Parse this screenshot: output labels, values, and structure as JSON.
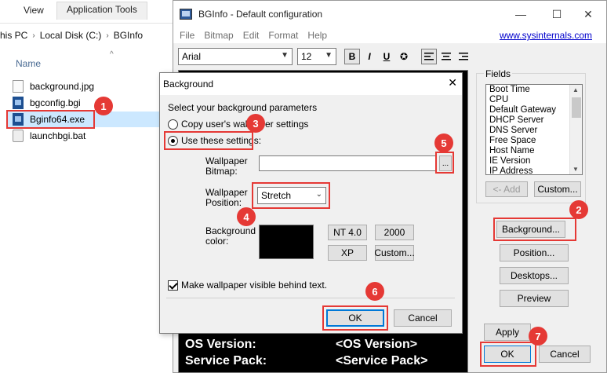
{
  "explorer": {
    "tabs": [
      "View",
      "Application Tools"
    ],
    "breadcrumb": [
      "his PC",
      "Local Disk (C:)",
      "BGInfo"
    ],
    "column_header": "Name",
    "files": [
      {
        "name": "background.jpg"
      },
      {
        "name": "bgconfig.bgi"
      },
      {
        "name": "Bginfo64.exe"
      },
      {
        "name": "launchbgi.bat"
      }
    ]
  },
  "bginfo": {
    "title": "BGInfo - Default configuration",
    "window_controls": {
      "minimize": "—",
      "maximize": "☐",
      "close": "✕"
    },
    "menu": [
      "File",
      "Bitmap",
      "Edit",
      "Format",
      "Help"
    ],
    "link": "www.sysinternals.com",
    "font_name": "Arial",
    "font_size": "12",
    "format_buttons": [
      "B",
      "I",
      "U",
      "✪"
    ],
    "editor_lines": [
      {
        "label": "OS Version:",
        "value": "<OS Version>"
      },
      {
        "label": "Service Pack:",
        "value": "<Service Pack>"
      }
    ],
    "fields_label": "Fields",
    "fields": [
      "Boot Time",
      "CPU",
      "Default Gateway",
      "DHCP Server",
      "DNS Server",
      "Free Space",
      "Host Name",
      "IE Version",
      "IP Address"
    ],
    "add_button": "<- Add",
    "custom_button": "Custom...",
    "side_buttons": [
      "Background...",
      "Position...",
      "Desktops...",
      "Preview"
    ],
    "apply_button": "Apply",
    "ok_button": "OK",
    "cancel_button": "Cancel"
  },
  "dialog": {
    "title": "Background",
    "close": "✕",
    "prompt": "Select your background parameters",
    "radio_copy": "Copy user's wallpaper settings",
    "radio_use": "Use these settings:",
    "wallpaper_bitmap_label_1": "Wallpaper",
    "wallpaper_bitmap_label_2": "Bitmap:",
    "wallpaper_bitmap_value": "",
    "browse_button": "...",
    "wallpaper_position_label_1": "Wallpaper",
    "wallpaper_position_label_2": "Position:",
    "wallpaper_position_value": "Stretch",
    "bg_color_label_1": "Background",
    "bg_color_label_2": "color:",
    "color_swatch": "#000000",
    "color_buttons": [
      "NT 4.0",
      "2000",
      "XP",
      "Custom..."
    ],
    "checkbox_label": "Make wallpaper visible behind text.",
    "ok_button": "OK",
    "cancel_button": "Cancel"
  },
  "callouts": [
    "1",
    "2",
    "3",
    "4",
    "5",
    "6",
    "7"
  ],
  "accent_color": "#e53935"
}
